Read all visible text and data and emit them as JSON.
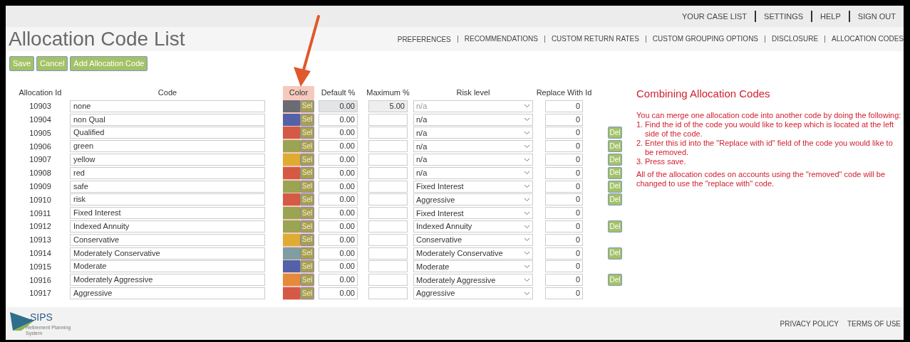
{
  "top_links": [
    "YOUR CASE LIST",
    "SETTINGS",
    "HELP",
    "SIGN OUT"
  ],
  "title": "Allocation Code List",
  "sub_nav": [
    "PREFERENCES",
    "RECOMMENDATIONS",
    "CUSTOM RETURN RATES",
    "CUSTOM GROUPING OPTIONS",
    "DISCLOSURE",
    "ALLOCATION CODES"
  ],
  "buttons": [
    "Save",
    "Cancel",
    "Add Allocation Code"
  ],
  "table": {
    "columns": [
      {
        "label": "Allocation Id",
        "highlighted": false
      },
      {
        "label": "Code",
        "highlighted": false
      },
      {
        "label": "Color",
        "highlighted": true
      },
      {
        "label": "Default %",
        "highlighted": false
      },
      {
        "label": "Maximum %",
        "highlighted": false
      },
      {
        "label": "Risk level",
        "highlighted": false
      },
      {
        "label": "Replace With Id",
        "highlighted": false
      }
    ],
    "rows": [
      {
        "id": "10903",
        "code": "none",
        "color": "#6b6b73",
        "select": "Sel",
        "default": "0.00",
        "maximum": "5.00",
        "risk": "n/a",
        "replace": "0",
        "locked": true,
        "delete": null
      },
      {
        "id": "10904",
        "code": "non Qual",
        "color": "#5460a8",
        "select": "Sel",
        "default": "0.00",
        "risk": "n/a",
        "replace": "0",
        "locked": false,
        "delete": null
      },
      {
        "id": "10905",
        "code": "Qualified",
        "color": "#d45a45",
        "select": "Sel",
        "default": "0.00",
        "risk": "n/a",
        "replace": "0",
        "locked": false,
        "delete": "Del"
      },
      {
        "id": "10906",
        "code": "green",
        "color": "#9aa452",
        "select": "Sel",
        "default": "0.00",
        "risk": "n/a",
        "replace": "0",
        "locked": false,
        "delete": "Del"
      },
      {
        "id": "10907",
        "code": "yellow",
        "color": "#e0ab32",
        "select": "Sel",
        "default": "0.00",
        "risk": "n/a",
        "replace": "0",
        "locked": false,
        "delete": "Del"
      },
      {
        "id": "10908",
        "code": "red",
        "color": "#d45a45",
        "select": "Sel",
        "default": "0.00",
        "risk": "n/a",
        "replace": "0",
        "locked": false,
        "delete": "Del"
      },
      {
        "id": "10909",
        "code": "safe",
        "color": "#9aa452",
        "select": "Sel",
        "default": "0.00",
        "risk": "Fixed Interest",
        "replace": "0",
        "locked": false,
        "delete": "Del"
      },
      {
        "id": "10910",
        "code": "risk",
        "color": "#d45a45",
        "select": "Sel",
        "default": "0.00",
        "risk": "Aggressive",
        "replace": "0",
        "locked": false,
        "delete": "Del"
      },
      {
        "id": "10911",
        "code": "Fixed Interest",
        "color": "#9aa452",
        "select": "Sel",
        "default": "0.00",
        "risk": "Fixed Interest",
        "replace": "0",
        "locked": false,
        "delete": null
      },
      {
        "id": "10912",
        "code": "Indexed Annuity",
        "color": "#9aa452",
        "select": "Sel",
        "default": "0.00",
        "risk": "Indexed Annuity",
        "replace": "0",
        "locked": false,
        "delete": "Del"
      },
      {
        "id": "10913",
        "code": "Conservative",
        "color": "#e0ab32",
        "select": "Sel",
        "default": "0.00",
        "risk": "Conservative",
        "replace": "0",
        "locked": false,
        "delete": null
      },
      {
        "id": "10914",
        "code": "Moderately Conservative",
        "color": "#7f9ea3",
        "select": "Sel",
        "default": "0.00",
        "risk": "Moderately Conservative",
        "replace": "0",
        "locked": false,
        "delete": "Del"
      },
      {
        "id": "10915",
        "code": "Moderate",
        "color": "#5460a8",
        "select": "Sel",
        "default": "0.00",
        "risk": "Moderate",
        "replace": "0",
        "locked": false,
        "delete": null
      },
      {
        "id": "10916",
        "code": "Moderately Aggressive",
        "color": "#e58a3a",
        "select": "Sel",
        "default": "0.00",
        "risk": "Moderately Aggressive",
        "replace": "0",
        "locked": false,
        "delete": "Del"
      },
      {
        "id": "10917",
        "code": "Aggressive",
        "color": "#d45a45",
        "select": "Sel",
        "default": "0.00",
        "risk": "Aggressive",
        "replace": "0",
        "locked": false,
        "delete": null
      }
    ]
  },
  "help": {
    "title": "Combining Allocation Codes",
    "intro": "You can merge one allocation code into another code by doing the following:",
    "steps": [
      {
        "number": "1.",
        "text": "Find the id of the code you would like to keep which is located at the left side of the code."
      },
      {
        "number": "2.",
        "text": "Enter this id into the \"Replace with id\" field of the code you would like to be removed."
      },
      {
        "number": "3.",
        "text": "Press save."
      }
    ],
    "outro": "All of the allocation codes on accounts using the \"removed\" code will be changed to use the \"replace with\" code."
  },
  "footer": {
    "logo": "SIPS",
    "tagline": "Retirement Planning System",
    "links": [
      "PRIVACY POLICY",
      "TERMS OF USE"
    ]
  }
}
